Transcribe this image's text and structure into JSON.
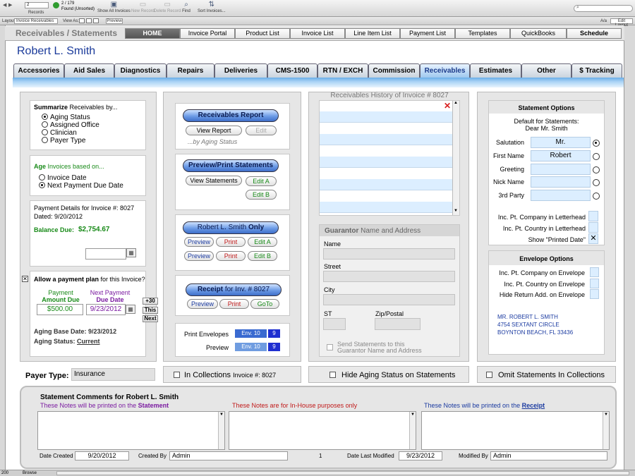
{
  "toolbar": {
    "record_field": "2",
    "records_label": "Records",
    "found_count": "2 / 179",
    "found_label": "Found (Unsorted)",
    "show_all": "Show All Invoices",
    "new_record": "New Record",
    "delete_record": "Delete Record",
    "find": "Find",
    "sort": "Sort Invoices..."
  },
  "layout_bar": {
    "layout_label": "Layout:",
    "layout_value": "Invoice Receivables",
    "view_label": "View As:",
    "preview": "Preview",
    "aa": "A/a",
    "edit_layout": "Edit Layout"
  },
  "header": {
    "title": "Receivables / Statements",
    "nav": [
      "HOME",
      "Invoice Portal",
      "Product List",
      "Invoice List",
      "Line Item List",
      "Payment List",
      "Templates",
      "QuickBooks",
      "Schedule"
    ]
  },
  "patient_name": "Robert L. Smith",
  "tabs": [
    "Accessories",
    "Aid Sales",
    "Diagnostics",
    "Repairs",
    "Deliveries",
    "CMS-1500",
    "RTN / EXCH",
    "Commission",
    "Receivables",
    "Estimates",
    "Other",
    "$ Tracking"
  ],
  "left": {
    "summarize_bold": "Summarize",
    "summarize_rest": "Receivables by...",
    "summarize_options": [
      "Aging Status",
      "Assigned Office",
      "Clinician",
      "Payer Type"
    ],
    "summarize_selected": "Aging Status",
    "age_green": "Age",
    "age_rest": "Invoices based on...",
    "age_options": [
      "Invoice Date",
      "Next Payment Due Date"
    ],
    "age_selected": "Next Payment Due Date",
    "payment_details": "Payment Details for Invoice #: 8027",
    "dated": "Dated: 9/20/2012",
    "balance_label": "Balance Due:",
    "balance_value": "$2,754.67",
    "date_field": "",
    "plan_bold": "Allow a payment plan",
    "plan_rest": "for this Invoice?",
    "payment_amount_h1": "Payment",
    "payment_amount_h2": "Amount Due",
    "next_payment_h1": "Next Payment",
    "next_payment_h2": "Due Date",
    "amount_due": "$500.00",
    "due_date": "9/23/2012",
    "btn_plus30": "+30",
    "btn_this": "This",
    "btn_next": "Next",
    "aging_base_label": "Aging Base Date:",
    "aging_base_value": "9/23/2012",
    "aging_status_label": "Aging Status:",
    "aging_status_value": "Current"
  },
  "payer": {
    "label": "Payer Type:",
    "value": "Insurance"
  },
  "middle": {
    "receivables_report": "Receivables Report",
    "view_report": "View Report",
    "edit": "Edit",
    "by_aging": "...by Aging Status",
    "preview_print": "Preview/Print Statements",
    "view_statements": "View Statements",
    "edit_a": "Edit A",
    "edit_b": "Edit B",
    "only_name": "Robert L. Smith",
    "only_word": "Only",
    "preview": "Preview",
    "print": "Print",
    "receipt_bold": "Receipt",
    "receipt_rest": "for Inv. # 8027",
    "goto": "GoTo",
    "print_envelopes": "Print Envelopes",
    "preview_label": "Preview",
    "env10": "Env. 10",
    "env_num": "9",
    "in_collections": "In Collections",
    "in_collections_inv": "Invoice #: 8027"
  },
  "history": {
    "title": "Receivables History of Invoice # 8027",
    "guarantor_bold": "Guarantor",
    "guarantor_rest": "Name and Address",
    "name": "Name",
    "street": "Street",
    "city": "City",
    "st": "ST",
    "zip": "Zip/Postal",
    "send_statements_1": "Send Statements to this",
    "send_statements_2": "Guarantor Name and Address",
    "hide_aging": "Hide Aging Status on Statements"
  },
  "statement_options": {
    "title": "Statement Options",
    "default_1": "Default for Statements:",
    "default_2": "Dear Mr. Smith",
    "salutation_label": "Salutation",
    "salutation_value": "Mr.",
    "first_name_label": "First Name",
    "first_name_value": "Robert",
    "greeting_label": "Greeting",
    "nick_name_label": "Nick Name",
    "third_party_label": "3rd Party",
    "inc_company_letterhead": "Inc. Pt. Company in Letterhead",
    "inc_country_letterhead": "Inc. Pt. Country in Letterhead",
    "show_printed_date": "Show \"Printed Date\"",
    "envelope_title": "Envelope Options",
    "inc_company_env": "Inc. Pt. Company on Envelope",
    "inc_country_env": "Inc. Pt. Country on Envelope",
    "hide_return": "Hide Return Add. on Envelope",
    "address": [
      "MR. ROBERT L. SMITH",
      "4754 SEXTANT CIRCLE",
      "BOYNTON BEACH, FL 33436"
    ],
    "omit_statements": "Omit Statements In Collections"
  },
  "comments": {
    "title": "Statement Comments for Robert L. Smith",
    "note1_a": "These Notes will be printed on the",
    "note1_b": "Statement",
    "note2": "These Notes are for In-House purposes only",
    "note3_a": "These Notes will be printed on the",
    "note3_b": "Receipt",
    "date_created_label": "Date Created",
    "date_created": "9/20/2012",
    "created_by_label": "Created By",
    "created_by": "Admin",
    "page_num": "1",
    "date_modified_label": "Date Last Modified",
    "date_modified": "9/23/2012",
    "modified_by_label": "Modified By",
    "modified_by": "Admin"
  },
  "statusbar": {
    "zoom": "200",
    "mode": "Browse"
  },
  "colors": {
    "accent_blue": "#1a3a9a",
    "green_text": "#188a18",
    "purple_text": "#7a1aa0",
    "red_text": "#c01818"
  }
}
